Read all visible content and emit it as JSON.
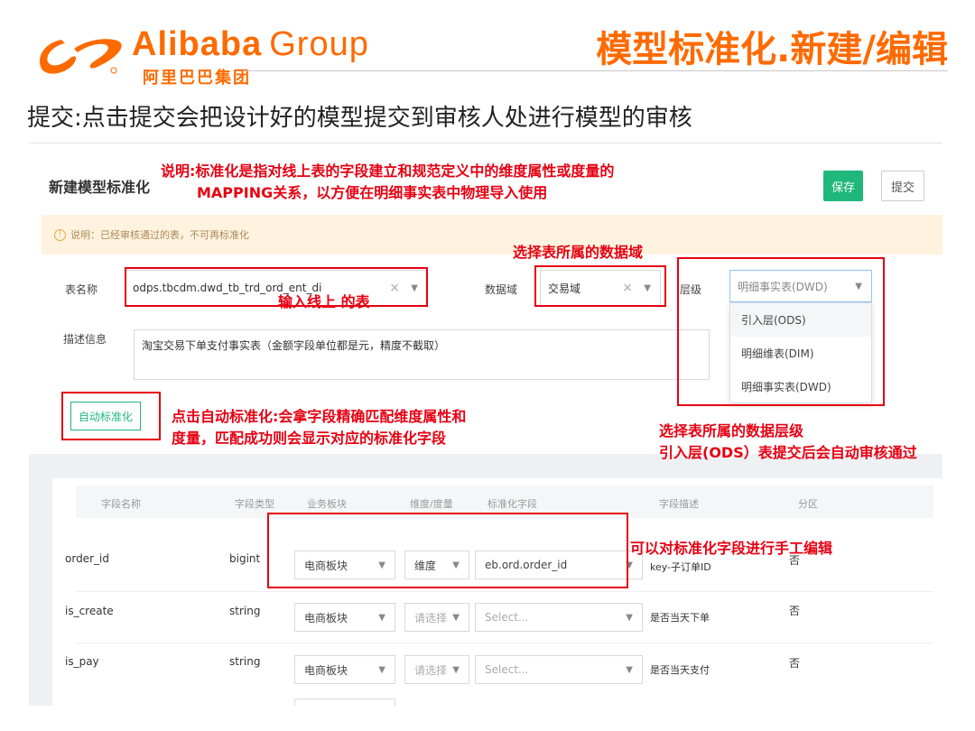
{
  "brand": {
    "name": "Alibaba",
    "group": "Group",
    "name_cn": "阿里巴巴集团"
  },
  "slide": {
    "title": "模型标准化.新建/编辑",
    "subtitle": "提交:点击提交会把设计好的模型提交到审核人处进行模型的审核"
  },
  "form": {
    "title": "新建模型标准化",
    "save_label": "保存",
    "submit_label": "提交",
    "notice": "说明：已经审核通过的表，不可再标准化",
    "table_name_label": "表名称",
    "table_name_value": "odps.tbcdm.dwd_tb_trd_ord_ent_di",
    "domain_label": "数据域",
    "domain_value": "交易域",
    "level_label": "层级",
    "level_value": "明细事实表(DWD)",
    "level_options": [
      "引入层(ODS)",
      "明细维表(DIM)",
      "明细事实表(DWD)"
    ],
    "desc_label": "描述信息",
    "desc_value": "淘宝交易下单支付事实表（金额字段单位都是元，精度不截取）",
    "auto_button": "自动标准化"
  },
  "table": {
    "headers": [
      "字段名称",
      "字段类型",
      "业务板块",
      "维度/度量",
      "标准化字段",
      "字段描述",
      "分区"
    ],
    "rows": [
      {
        "name": "order_id",
        "type": "bigint",
        "business": "电商板块",
        "dim": "维度",
        "std": "eb.ord.order_id",
        "desc": "key-子订单ID",
        "partition": "否"
      },
      {
        "name": "is_create",
        "type": "string",
        "business": "电商板块",
        "dim": "请选择",
        "std": "Select...",
        "desc": "是否当天下单",
        "partition": "否"
      },
      {
        "name": "is_pay",
        "type": "string",
        "business": "电商板块",
        "dim": "请选择",
        "std": "Select...",
        "desc": "是否当天支付",
        "partition": "否"
      }
    ]
  },
  "annotations": {
    "a1_line1": "说明:标准化是指对线上表的字段建立和规范定义中的维度属性或度量的",
    "a1_line2": "MAPPING关系，以方便在明细事实表中物理导入使用",
    "a2": "选择表所属的数据域",
    "a3": "输入线上 的表",
    "a4_line1": "点击自动标准化:会拿字段精确匹配维度属性和",
    "a4_line2": "度量，匹配成功则会显示对应的标准化字段",
    "a5_line1": "选择表所属的数据层级",
    "a5_line2": "引入层(ODS）表提交后会自动审核通过",
    "a6": "可以对标准化字段进行手工编辑"
  },
  "colors": {
    "brand": "#ff6a00",
    "annotation": "#e60012",
    "primary": "#1fb77b"
  }
}
